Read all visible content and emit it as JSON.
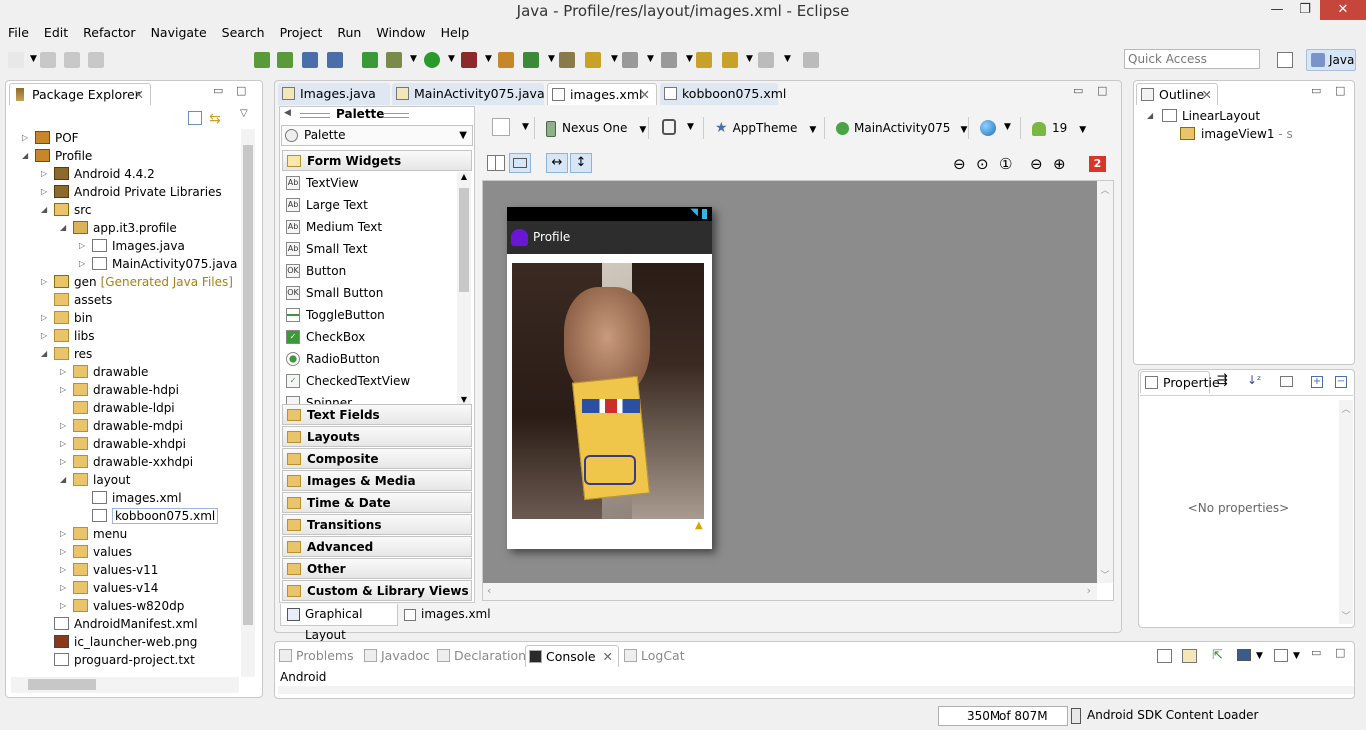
{
  "window": {
    "title": "Java - Profile/res/layout/images.xml - Eclipse",
    "icon": "eclipse-logo-icon"
  },
  "menu": [
    "File",
    "Edit",
    "Refactor",
    "Navigate",
    "Search",
    "Project",
    "Run",
    "Window",
    "Help"
  ],
  "toolbar": {
    "quick_access_placeholder": "Quick Access",
    "perspective": "Java"
  },
  "package_explorer": {
    "title": "Package Explorer",
    "tree": [
      {
        "label": "POF",
        "level": 1,
        "expanded": false,
        "icon": "project-icon"
      },
      {
        "label": "Profile",
        "level": 1,
        "expanded": true,
        "icon": "project-icon"
      },
      {
        "label": "Android 4.4.2",
        "level": 2,
        "expanded": false,
        "icon": "library-icon"
      },
      {
        "label": "Android Private Libraries",
        "level": 2,
        "expanded": false,
        "icon": "library-icon"
      },
      {
        "label": "src",
        "level": 2,
        "expanded": true,
        "icon": "source-folder-icon"
      },
      {
        "label": "app.it3.profile",
        "level": 3,
        "expanded": true,
        "icon": "package-icon"
      },
      {
        "label": "Images.java",
        "level": 4,
        "expanded": false,
        "icon": "java-file-icon"
      },
      {
        "label": "MainActivity075.java",
        "level": 4,
        "expanded": false,
        "icon": "java-file-icon"
      },
      {
        "label": "gen",
        "suffix": "[Generated Java Files]",
        "level": 2,
        "expanded": false,
        "icon": "source-folder-icon"
      },
      {
        "label": "assets",
        "level": 2,
        "leaf": true,
        "icon": "folder-icon"
      },
      {
        "label": "bin",
        "level": 2,
        "expanded": false,
        "icon": "folder-icon"
      },
      {
        "label": "libs",
        "level": 2,
        "expanded": false,
        "icon": "folder-icon"
      },
      {
        "label": "res",
        "level": 2,
        "expanded": true,
        "icon": "folder-icon"
      },
      {
        "label": "drawable",
        "level": 3,
        "expanded": false,
        "icon": "folder-icon"
      },
      {
        "label": "drawable-hdpi",
        "level": 3,
        "expanded": false,
        "icon": "folder-icon"
      },
      {
        "label": "drawable-ldpi",
        "level": 3,
        "leaf": true,
        "icon": "folder-icon"
      },
      {
        "label": "drawable-mdpi",
        "level": 3,
        "expanded": false,
        "icon": "folder-icon"
      },
      {
        "label": "drawable-xhdpi",
        "level": 3,
        "expanded": false,
        "icon": "folder-icon"
      },
      {
        "label": "drawable-xxhdpi",
        "level": 3,
        "expanded": false,
        "icon": "folder-icon"
      },
      {
        "label": "layout",
        "level": 3,
        "expanded": true,
        "icon": "folder-icon"
      },
      {
        "label": "images.xml",
        "level": 4,
        "leaf": true,
        "icon": "xml-file-icon"
      },
      {
        "label": "kobboon075.xml",
        "level": 4,
        "leaf": true,
        "selected": true,
        "icon": "xml-file-icon"
      },
      {
        "label": "menu",
        "level": 3,
        "expanded": false,
        "icon": "folder-icon"
      },
      {
        "label": "values",
        "level": 3,
        "expanded": false,
        "icon": "folder-icon"
      },
      {
        "label": "values-v11",
        "level": 3,
        "expanded": false,
        "icon": "folder-icon"
      },
      {
        "label": "values-v14",
        "level": 3,
        "expanded": false,
        "icon": "folder-icon"
      },
      {
        "label": "values-w820dp",
        "level": 3,
        "expanded": false,
        "icon": "folder-icon"
      },
      {
        "label": "AndroidManifest.xml",
        "level": 2,
        "leaf": true,
        "icon": "android-manifest-icon"
      },
      {
        "label": "ic_launcher-web.png",
        "level": 2,
        "leaf": true,
        "icon": "image-file-icon"
      },
      {
        "label": "proguard-project.txt",
        "level": 2,
        "leaf": true,
        "icon": "text-file-icon"
      }
    ]
  },
  "editor": {
    "tabs": [
      {
        "label": "Images.java",
        "active": false
      },
      {
        "label": "MainActivity075.java",
        "active": false
      },
      {
        "label": "images.xml",
        "active": true
      },
      {
        "label": "kobboon075.xml",
        "active": false
      }
    ],
    "palette": {
      "header": "Palette",
      "selector": "Palette",
      "open_group": "Form Widgets",
      "widgets": [
        {
          "label": "TextView",
          "icon": "Ab"
        },
        {
          "label": "Large Text",
          "icon": "Ab"
        },
        {
          "label": "Medium Text",
          "icon": "Ab"
        },
        {
          "label": "Small Text",
          "icon": "Ab"
        },
        {
          "label": "Button",
          "icon": "OK"
        },
        {
          "label": "Small Button",
          "icon": "OK"
        },
        {
          "label": "ToggleButton",
          "icon": "toggle"
        },
        {
          "label": "CheckBox",
          "icon": "check"
        },
        {
          "label": "RadioButton",
          "icon": "radio"
        },
        {
          "label": "CheckedTextView",
          "icon": "checked-text"
        },
        {
          "label": "Spinner",
          "icon": "spinner"
        }
      ],
      "groups": [
        "Text Fields",
        "Layouts",
        "Composite",
        "Images & Media",
        "Time & Date",
        "Transitions",
        "Advanced",
        "Other",
        "Custom & Library Views"
      ]
    },
    "config": {
      "device": "Nexus One",
      "theme": "AppTheme",
      "activity": "MainActivity075",
      "api": "19",
      "error_count": "2"
    },
    "preview": {
      "app_title": "Profile"
    },
    "bottom_tabs": [
      {
        "label": "Graphical Layout",
        "active": true
      },
      {
        "label": "images.xml",
        "active": false
      }
    ]
  },
  "outline": {
    "title": "Outline",
    "items": [
      {
        "label": "LinearLayout"
      },
      {
        "label": "imageView1",
        "suffix": " - s"
      }
    ]
  },
  "properties": {
    "title": "Propertie",
    "empty": "<No properties>"
  },
  "console": {
    "tabs": [
      {
        "label": "Problems",
        "active": false
      },
      {
        "label": "Javadoc",
        "active": false
      },
      {
        "label": "Declaration",
        "active": false
      },
      {
        "label": "Console",
        "active": true
      },
      {
        "label": "LogCat",
        "active": false
      }
    ],
    "content": "Android"
  },
  "status": {
    "heap_used": "350M",
    "heap_total": "of 807M",
    "task": "Android SDK Content Loader"
  },
  "colors": {
    "accent": "#d6e6f6",
    "error_badge": "#d9362b",
    "action_bar": "#2d2d2d",
    "canvas_bg": "#8c8c8c"
  }
}
